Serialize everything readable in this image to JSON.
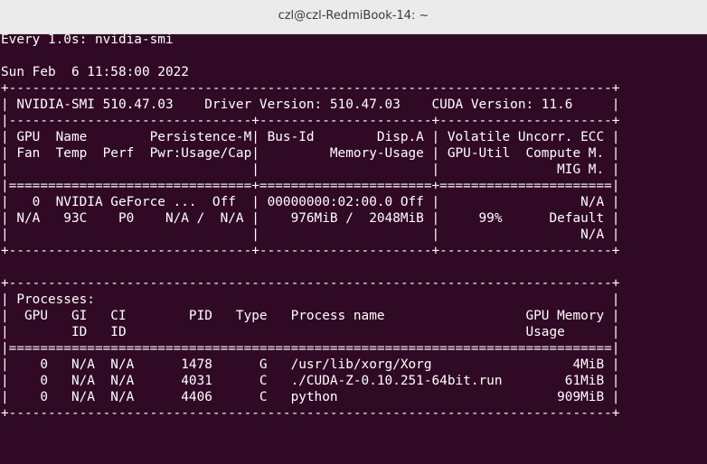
{
  "window": {
    "title": "czl@czl-RedmiBook-14: ~"
  },
  "terminal": {
    "lines": [
      "Every 1.0s: nvidia-smi",
      "",
      "Sun Feb  6 11:58:00 2022",
      "+-----------------------------------------------------------------------------+",
      "| NVIDIA-SMI 510.47.03    Driver Version: 510.47.03    CUDA Version: 11.6     |",
      "|-------------------------------+----------------------+----------------------+",
      "| GPU  Name        Persistence-M| Bus-Id        Disp.A | Volatile Uncorr. ECC |",
      "| Fan  Temp  Perf  Pwr:Usage/Cap|         Memory-Usage | GPU-Util  Compute M. |",
      "|                               |                      |               MIG M. |",
      "|===============================+======================+======================|",
      "|   0  NVIDIA GeForce ...  Off  | 00000000:02:00.0 Off |                  N/A |",
      "| N/A   93C    P0    N/A /  N/A |    976MiB /  2048MiB |     99%      Default |",
      "|                               |                      |                  N/A |",
      "+-------------------------------+----------------------+----------------------+",
      "",
      "+-----------------------------------------------------------------------------+",
      "| Processes:                                                                  |",
      "|  GPU   GI   CI        PID   Type   Process name                  GPU Memory |",
      "|        ID   ID                                                   Usage      |",
      "|=============================================================================|",
      "|    0   N/A  N/A      1478      G   /usr/lib/xorg/Xorg                  4MiB |",
      "|    0   N/A  N/A      4031      C   ./CUDA-Z-0.10.251-64bit.run        61MiB |",
      "|    0   N/A  N/A      4406      C   python                            909MiB |",
      "+-----------------------------------------------------------------------------+"
    ]
  },
  "colors": {
    "terminal_background": "#300a24",
    "terminal_foreground": "#ffffff",
    "titlebar_background": "#ebebeb"
  }
}
